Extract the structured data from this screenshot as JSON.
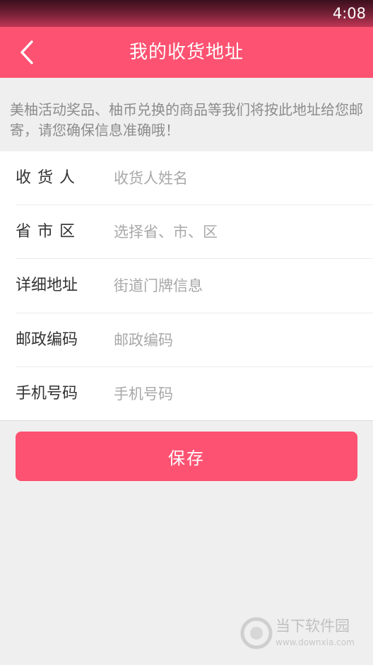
{
  "status_bar": {
    "time": "4:08"
  },
  "header": {
    "title": "我的收货地址"
  },
  "notice": {
    "text": "美柚活动奖品、柚币兑换的商品等我们将按此地址给您邮寄，请您确保信息准确哦！"
  },
  "form": {
    "rows": [
      {
        "label": "收货人",
        "placeholder": "收货人姓名",
        "value": ""
      },
      {
        "label": "省市区",
        "placeholder": "选择省、市、区",
        "value": ""
      },
      {
        "label": "详细地址",
        "placeholder": "街道门牌信息",
        "value": ""
      },
      {
        "label": "邮政编码",
        "placeholder": "邮政编码",
        "value": ""
      },
      {
        "label": "手机号码",
        "placeholder": "手机号码",
        "value": ""
      }
    ]
  },
  "actions": {
    "save_label": "保存"
  },
  "watermark": {
    "title": "当下软件园",
    "url": "www.downxia.com"
  },
  "colors": {
    "brand": "#fd5271",
    "background": "#efefef",
    "placeholder": "#a8a8a8",
    "notice_text": "#8c8c8c"
  },
  "icons": {
    "back": "chevron-left-icon",
    "watermark_logo": "downxia-logo-icon"
  }
}
